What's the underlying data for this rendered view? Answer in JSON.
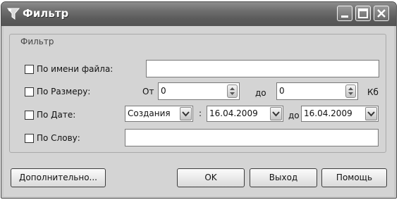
{
  "window": {
    "title": "Фильтр",
    "icons": {
      "app": "filter-funnel-icon",
      "minimize": "minimize-icon",
      "maximize": "maximize-icon",
      "close": "close-icon"
    }
  },
  "filter_group": {
    "label": "Фильтр",
    "by_filename": {
      "label": "По имени файла:",
      "checked": false,
      "value": ""
    },
    "by_size": {
      "label": "По Размеру:",
      "from_label": "От",
      "from_value": "0",
      "to_label": "до",
      "to_value": "0",
      "unit": "Кб",
      "checked": false
    },
    "by_date": {
      "label": "По Дате:",
      "type_value": "Создания",
      "separator": ":",
      "from_date": "16.04.2009",
      "to_label": "до",
      "to_date": "16.04.2009",
      "checked": false
    },
    "by_word": {
      "label": "По Слову:",
      "checked": false,
      "value": ""
    }
  },
  "buttons": {
    "advanced": "Дополнительно...",
    "ok": "OK",
    "exit": "Выход",
    "help": "Помощь"
  }
}
